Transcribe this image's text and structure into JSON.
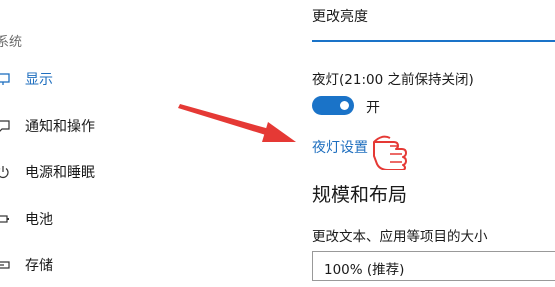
{
  "sidebar": {
    "category": "系统",
    "items": [
      {
        "label": "显示",
        "icon": "monitor-icon",
        "active": true
      },
      {
        "label": "通知和操作",
        "icon": "message-icon",
        "active": false
      },
      {
        "label": "电源和睡眠",
        "icon": "power-icon",
        "active": false
      },
      {
        "label": "电池",
        "icon": "battery-icon",
        "active": false
      },
      {
        "label": "存储",
        "icon": "storage-icon",
        "active": false
      }
    ]
  },
  "main": {
    "brightness_title": "更改亮度",
    "night_light_label": "夜灯(21:00 之前保持关闭)",
    "night_light_toggle": {
      "on": true,
      "state_label": "开"
    },
    "night_light_settings_link": "夜灯设置",
    "scale_section_heading": "规模和布局",
    "scale_label": "更改文本、应用等项目的大小",
    "scale_value": "100% (推荐)"
  },
  "colors": {
    "accent": "#1a73c8",
    "annotation": "#e53935"
  }
}
